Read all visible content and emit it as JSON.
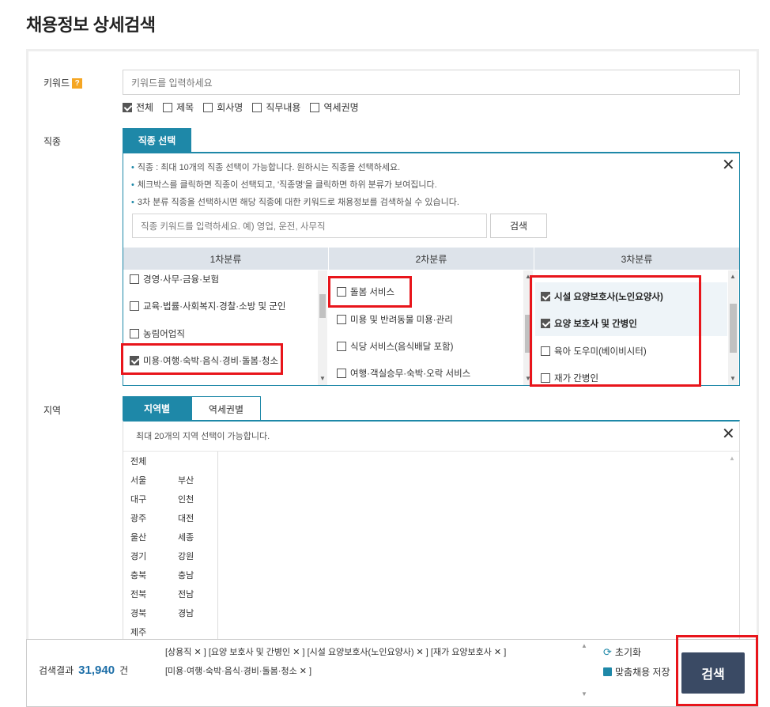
{
  "page_title": "채용정보 상세검색",
  "keyword": {
    "label": "키워드",
    "badge": "?",
    "placeholder": "키워드를 입력하세요",
    "options": [
      {
        "label": "전체",
        "checked": true
      },
      {
        "label": "제목",
        "checked": false
      },
      {
        "label": "회사명",
        "checked": false
      },
      {
        "label": "직무내용",
        "checked": false
      },
      {
        "label": "역세권명",
        "checked": false
      }
    ]
  },
  "job": {
    "label": "직종",
    "tab": "직종 선택",
    "notes": [
      "직종 : 최대 10개의 직종 선택이 가능합니다. 원하시는 직종을 선택하세요.",
      "체크박스를 클릭하면 직종이 선택되고, '직종명'을 클릭하면 하위 분류가 보여집니다.",
      "3차 분류 직종을 선택하시면 해당 직종에 대한 키워드로 채용정보를 검색하실 수 있습니다."
    ],
    "search_placeholder": "직종 키워드를 입력하세요. 예) 영업, 운전, 사무직",
    "search_button": "검색",
    "close": "✕",
    "col_headers": [
      "1차분류",
      "2차분류",
      "3차분류"
    ],
    "col1": [
      {
        "label": "경영·사무·금융·보험",
        "checked": false
      },
      {
        "label": "교육·법률·사회복지·경찰·소방 및 군인",
        "checked": false
      },
      {
        "label": "농림어업직",
        "checked": false
      },
      {
        "label": "미용·여행·숙박·음식·경비·돌봄·청소",
        "checked": true
      }
    ],
    "col2": [
      {
        "label": "돌봄 서비스",
        "checked": false
      },
      {
        "label": "미용 및 반려동물 미용·관리",
        "checked": false
      },
      {
        "label": "식당 서비스(음식배달 포함)",
        "checked": false
      },
      {
        "label": "여행·객실승무·숙박·오락 서비스",
        "checked": false
      }
    ],
    "col3": [
      {
        "label": "시설 요양보호사(노인요양사)",
        "checked": true
      },
      {
        "label": "요양 보호사 및 간병인",
        "checked": true
      },
      {
        "label": "육아 도우미(베이비시터)",
        "checked": false
      },
      {
        "label": "재가 간병인",
        "checked": false
      }
    ]
  },
  "region": {
    "label": "지역",
    "tabs": [
      "지역별",
      "역세권별"
    ],
    "note": "최대 20개의 지역 선택이 가능합니다.",
    "close": "✕",
    "all": "전체",
    "pairs": [
      [
        "서울",
        "부산"
      ],
      [
        "대구",
        "인천"
      ],
      [
        "광주",
        "대전"
      ],
      [
        "울산",
        "세종"
      ],
      [
        "경기",
        "강원"
      ],
      [
        "충북",
        "충남"
      ],
      [
        "전북",
        "전남"
      ],
      [
        "경북",
        "경남"
      ],
      [
        "제주",
        ""
      ]
    ]
  },
  "bottom": {
    "result_label": "검색결과",
    "result_count": "31,940",
    "result_unit": "건",
    "tags_line1": "[상용직  ✕ ]   [요양 보호사 및 간병인  ✕ ]   [시설 요양보호사(노인요양사)  ✕ ]   [재가 요양보호사  ✕ ]",
    "tags_line2": "[미용·여행·숙박·음식·경비·돌봄·청소  ✕ ]",
    "reset": "초기화",
    "save": "맞춤채용 저장",
    "search": "검색"
  },
  "colors": {
    "accent": "#1e88a8",
    "highlight": "#e8151b",
    "search_button": "#3a4a64",
    "count": "#1e6fa8"
  }
}
